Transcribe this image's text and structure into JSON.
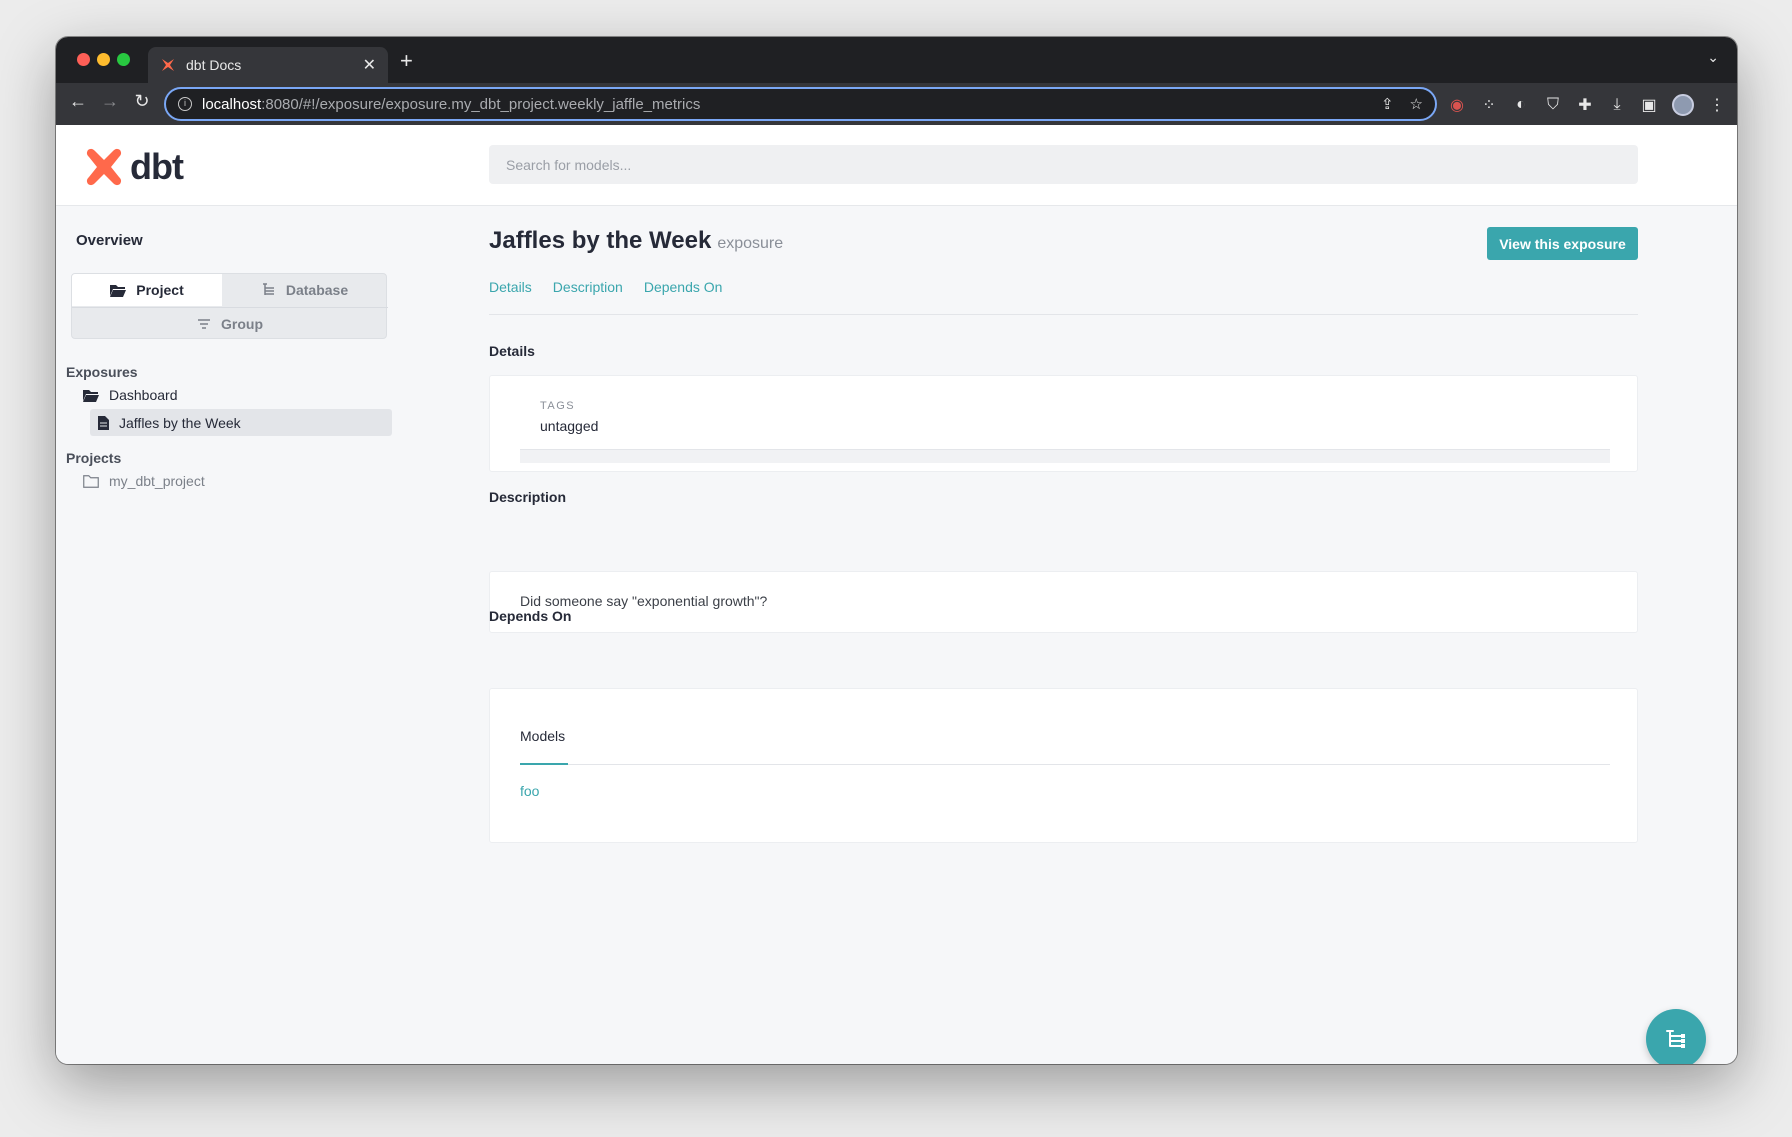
{
  "browser": {
    "tab_title": "dbt Docs",
    "url_host": "localhost",
    "url_path": ":8080/#!/exposure/exposure.my_dbt_project.weekly_jaffle_metrics"
  },
  "header": {
    "logo_text": "dbt",
    "search_placeholder": "Search for models..."
  },
  "sidebar": {
    "overview": "Overview",
    "switcher": {
      "project": "Project",
      "database": "Database",
      "group": "Group"
    },
    "exposures_label": "Exposures",
    "exposure_folder": "Dashboard",
    "exposure_item": "Jaffles by the Week",
    "projects_label": "Projects",
    "project_item": "my_dbt_project"
  },
  "main": {
    "title": "Jaffles by the Week",
    "type": "exposure",
    "view_button": "View this exposure",
    "anchors": [
      "Details",
      "Description",
      "Depends On"
    ],
    "details": {
      "heading": "Details",
      "tags_label": "TAGS",
      "tags_value": "untagged"
    },
    "description": {
      "heading": "Description",
      "text": "Did someone say \"exponential growth\"?"
    },
    "depends_on": {
      "heading": "Depends On",
      "tab": "Models",
      "models": [
        "foo"
      ]
    }
  },
  "colors": {
    "accent": "#3aa6ad",
    "brand": "#ff694b",
    "text": "#262a38"
  }
}
